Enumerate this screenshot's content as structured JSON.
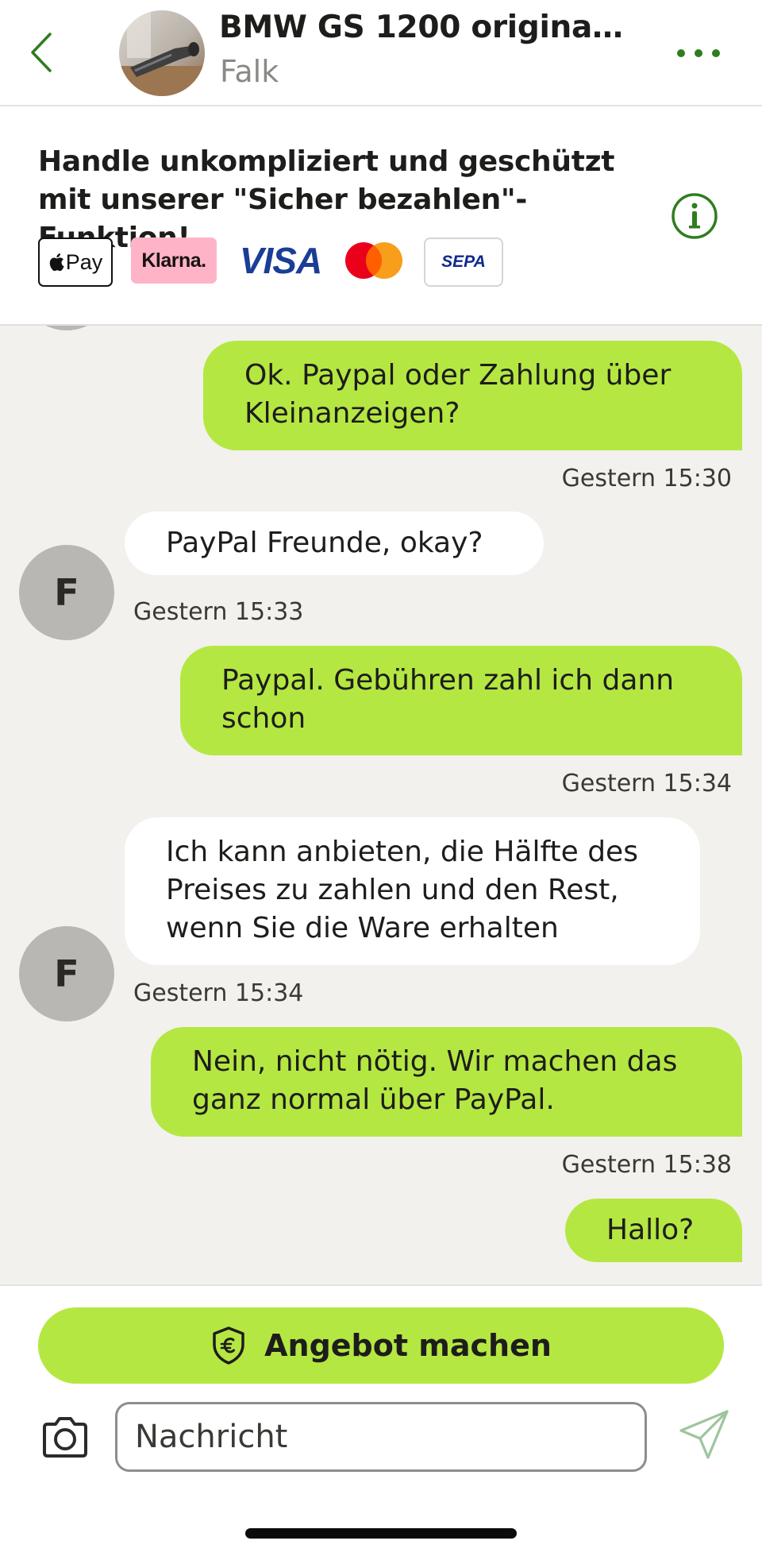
{
  "header": {
    "title": "BMW GS 1200 original...",
    "subtitle": "Falk"
  },
  "promo": {
    "text": "Handle unkompliziert und geschützt mit unserer \"Sicher bezahlen\"-Funktion!",
    "payment_methods": {
      "apple_pay": "Pay",
      "klarna": "Klarna.",
      "visa": "VISA",
      "sepa": "SEPA"
    }
  },
  "messages": [
    {
      "from": "me",
      "text": "Ok. Paypal oder Zahlung über Kleinanzeigen?",
      "time": "Gestern 15:30"
    },
    {
      "from": "them",
      "avatar": "F",
      "text": "PayPal Freunde, okay?",
      "time": "Gestern 15:33"
    },
    {
      "from": "me",
      "text": "Paypal. Gebühren zahl ich dann schon",
      "time": "Gestern 15:34"
    },
    {
      "from": "them",
      "avatar": "F",
      "text": "Ich kann anbieten, die Hälfte des Preises zu zahlen und den Rest, wenn Sie die Ware erhalten",
      "time": "Gestern 15:34"
    },
    {
      "from": "me",
      "text": "Nein, nicht nötig. Wir machen das ganz normal über PayPal.",
      "time": "Gestern 15:38"
    },
    {
      "from": "me",
      "text": "Hallo?"
    }
  ],
  "composer": {
    "offer_button": "Angebot machen",
    "placeholder": "Nachricht"
  },
  "colors": {
    "accent_green": "#b5e742",
    "icon_green": "#2f7d1f",
    "background": "#f2f1ee"
  },
  "icons": {
    "back": "chevron-left-icon",
    "more": "more-dots-icon",
    "info": "info-icon",
    "offer": "shield-euro-icon",
    "camera": "camera-icon",
    "send": "send-icon"
  }
}
